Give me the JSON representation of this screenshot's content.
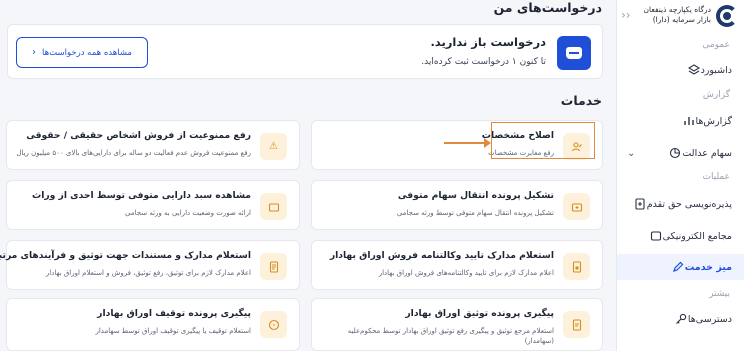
{
  "sidebar": {
    "brand": "درگاه یکپارچه ذینفعان بازار سرمایه (دارا)",
    "sections": {
      "general": "عمومی",
      "report": "گزارش",
      "operations": "عملیات",
      "more": "بیشتر"
    },
    "items": {
      "dashboard": "داشبورد",
      "reports": "گزارش‌ها",
      "justice": "سهام عدالت",
      "subscription": "پذیره‌نویسی حق تقدم",
      "assemblies": "مجامع الکترونیکی",
      "service_desk": "میز خدمت",
      "access": "دسترسی‌ها"
    }
  },
  "requests": {
    "heading": "درخواست‌های من",
    "title": "درخواست باز ندارید.",
    "subtitle": "تا کنون ۱ درخواست ثبت کرده‌اید.",
    "view_all": "مشاهده همه درخواست‌ها"
  },
  "services": {
    "heading": "خدمات",
    "items": [
      {
        "title": "اصلاح مشخصات",
        "desc": "رفع مغایرت مشخصات"
      },
      {
        "title": "رفع ممنوعیت از فروش اشخاص حقیقی / حقوقی",
        "desc": "رفع ممنوعیت فروش عدم فعالیت دو ساله برای دارایی‌های بالای ۵۰۰ میلیون ریال"
      },
      {
        "title": "تشکیل پرونده انتقال سهام متوفی",
        "desc": "تشکیل پرونده انتقال سهام متوفی توسط ورثه سجامی"
      },
      {
        "title": "مشاهده سبد دارایی متوفی توسط احدی از وراث",
        "desc": "ارائه صورت وضعیت دارایی به ورثه سجامی"
      },
      {
        "title": "استعلام مدارک تایید وکالتنامه فروش اوراق بهادار",
        "desc": "اعلام مدارک لازم برای تایید وکالتنامه‌های فروش اوراق بهادار"
      },
      {
        "title": "استعلام مدارک و مستندات جهت توثیق و فرآیندهای مرتبط",
        "desc": "اعلام مدارک لازم برای توثیق، رفع توثیق، فروش و استعلام اوراق بهادار"
      },
      {
        "title": "پیگیری پرونده توثیق اوراق بهادار",
        "desc": "استعلام مرجع توثیق و پیگیری رفع توثیق اوراق بهادار توسط محکوم‌علیه (سهامدار)"
      },
      {
        "title": "پیگیری پرونده توقیف اوراق بهادار",
        "desc": "استعلام توقیف یا پیگیری توقیف اوراق توسط سهامدار"
      }
    ]
  },
  "colors": {
    "accent": "#1e4fd6",
    "icon_bg": "#fdf1dc",
    "highlight": "#e08a3c"
  }
}
